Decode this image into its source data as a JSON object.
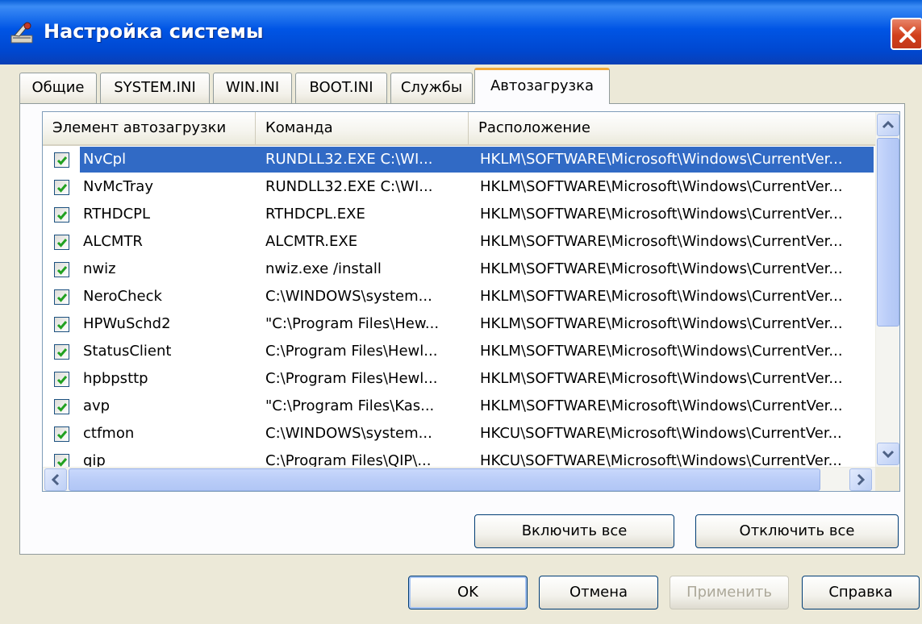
{
  "window": {
    "title": "Настройка системы"
  },
  "tabs": [
    {
      "label": "Общие"
    },
    {
      "label": "SYSTEM.INI"
    },
    {
      "label": "WIN.INI"
    },
    {
      "label": "BOOT.INI"
    },
    {
      "label": "Службы"
    },
    {
      "label": "Автозагрузка",
      "active": true
    }
  ],
  "startup_list": {
    "columns": [
      "Элемент автозагрузки",
      "Команда",
      "Расположение"
    ],
    "rows": [
      {
        "item": "NvCpl",
        "command": "RUNDLL32.EXE C:\\WI...",
        "location": "HKLM\\SOFTWARE\\Microsoft\\Windows\\CurrentVer...",
        "checked": true,
        "selected": true
      },
      {
        "item": "NvMcTray",
        "command": "RUNDLL32.EXE C:\\WI...",
        "location": "HKLM\\SOFTWARE\\Microsoft\\Windows\\CurrentVer...",
        "checked": true
      },
      {
        "item": "RTHDCPL",
        "command": "RTHDCPL.EXE",
        "location": "HKLM\\SOFTWARE\\Microsoft\\Windows\\CurrentVer...",
        "checked": true
      },
      {
        "item": "ALCMTR",
        "command": "ALCMTR.EXE",
        "location": "HKLM\\SOFTWARE\\Microsoft\\Windows\\CurrentVer...",
        "checked": true
      },
      {
        "item": "nwiz",
        "command": "nwiz.exe /install",
        "location": "HKLM\\SOFTWARE\\Microsoft\\Windows\\CurrentVer...",
        "checked": true
      },
      {
        "item": "NeroCheck",
        "command": "C:\\WINDOWS\\system...",
        "location": "HKLM\\SOFTWARE\\Microsoft\\Windows\\CurrentVer...",
        "checked": true
      },
      {
        "item": "HPWuSchd2",
        "command": "\"C:\\Program Files\\Hew...",
        "location": "HKLM\\SOFTWARE\\Microsoft\\Windows\\CurrentVer...",
        "checked": true
      },
      {
        "item": "StatusClient",
        "command": "C:\\Program Files\\Hewl...",
        "location": "HKLM\\SOFTWARE\\Microsoft\\Windows\\CurrentVer...",
        "checked": true
      },
      {
        "item": "hpbpsttp",
        "command": "C:\\Program Files\\Hewl...",
        "location": "HKLM\\SOFTWARE\\Microsoft\\Windows\\CurrentVer...",
        "checked": true
      },
      {
        "item": "avp",
        "command": "\"C:\\Program Files\\Kas...",
        "location": "HKLM\\SOFTWARE\\Microsoft\\Windows\\CurrentVer...",
        "checked": true
      },
      {
        "item": "ctfmon",
        "command": "C:\\WINDOWS\\system...",
        "location": "HKCU\\SOFTWARE\\Microsoft\\Windows\\CurrentVer...",
        "checked": true
      },
      {
        "item": "qip",
        "command": "C:\\Program Files\\QIP\\...",
        "location": "HKCU\\SOFTWARE\\Microsoft\\Windows\\CurrentVer...",
        "checked": true
      }
    ]
  },
  "buttons": {
    "enable_all": "Включить все",
    "disable_all": "Отключить все",
    "ok": "OK",
    "cancel": "Отмена",
    "apply": "Применить",
    "help": "Справка"
  },
  "colors": {
    "titlebar": "#0055e5",
    "selection": "#316ac5",
    "active_tab_accent": "#f1a93a",
    "window_bg": "#ece9d8"
  },
  "icons": [
    "msconfig-icon",
    "close-icon",
    "checkbox-checked-icon",
    "scroll-up-icon",
    "scroll-down-icon",
    "scroll-left-icon",
    "scroll-right-icon"
  ]
}
